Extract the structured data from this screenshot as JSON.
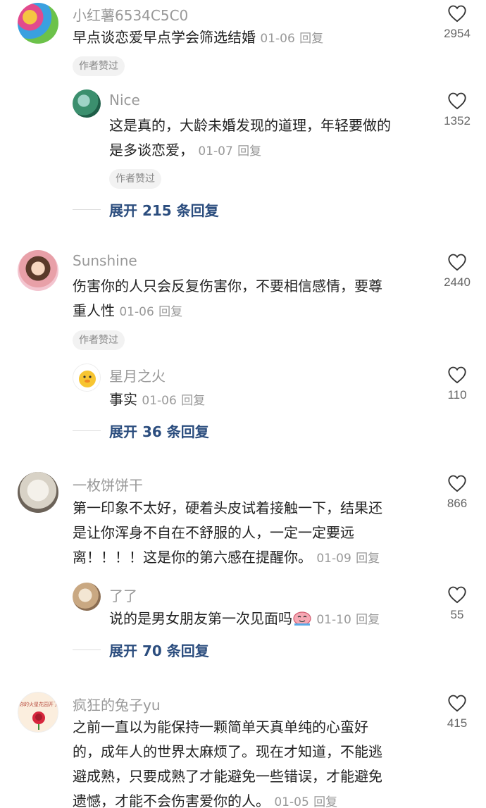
{
  "comments": [
    {
      "username": "小红薯6534C5C0",
      "lines": [
        "早点谈恋爱早点学会筛选结婚"
      ],
      "date": "01-06",
      "reply_label": "回复",
      "badge": "作者赞过",
      "likes": "2954",
      "sub_reply": {
        "username": "Nice",
        "lines": [
          "这是真的，大龄未婚发现的道理，年轻要做的",
          "是多谈恋爱，"
        ],
        "date": "01-07",
        "reply_label": "回复",
        "badge": "作者赞过",
        "likes": "1352"
      },
      "expand_label": "展开 215 条回复"
    },
    {
      "username": "Sunshine",
      "lines": [
        "伤害你的人只会反复伤害你，不要相信感情，要尊",
        "重人性"
      ],
      "date": "01-06",
      "reply_label": "回复",
      "badge": "作者赞过",
      "likes": "2440",
      "sub_reply": {
        "username": "星月之火",
        "lines": [
          "事实"
        ],
        "date": "01-06",
        "reply_label": "回复",
        "likes": "110"
      },
      "expand_label": "展开 36 条回复"
    },
    {
      "username": "一枚饼饼干",
      "lines": [
        "第一印象不太好，硬着头皮试着接触一下，结果还",
        "是让你浑身不自在不舒服的人，一定一定要远",
        "离！！！！这是你的第六感在提醒你。"
      ],
      "date": "01-09",
      "reply_label": "回复",
      "likes": "866",
      "sub_reply": {
        "username": "了了",
        "lines": [
          "说的是男女朋友第一次见面吗"
        ],
        "emoji": "crying-face-emoji",
        "date": "01-10",
        "reply_label": "回复",
        "likes": "55"
      },
      "expand_label": "展开 70 条回复"
    },
    {
      "username": "疯狂的兔子yu",
      "lines": [
        "之前一直以为能保持一颗简单天真单纯的心蛮好",
        "的，成年人的世界太麻烦了。现在才知道，不能逃",
        "避成熟，只要成熟了才能避免一些错误，才能避免",
        "遗憾，才能不会伤害爱你的人。"
      ],
      "date": "01-05",
      "reply_label": "回复",
      "likes": "415",
      "avatar_text": "你的火星花园开了"
    }
  ],
  "icons": {
    "like": "heart-outline-icon"
  },
  "colors": {
    "link": "#2b4d7e",
    "muted": "#999999",
    "text": "#222222",
    "badge_bg": "#f2f2f2"
  }
}
